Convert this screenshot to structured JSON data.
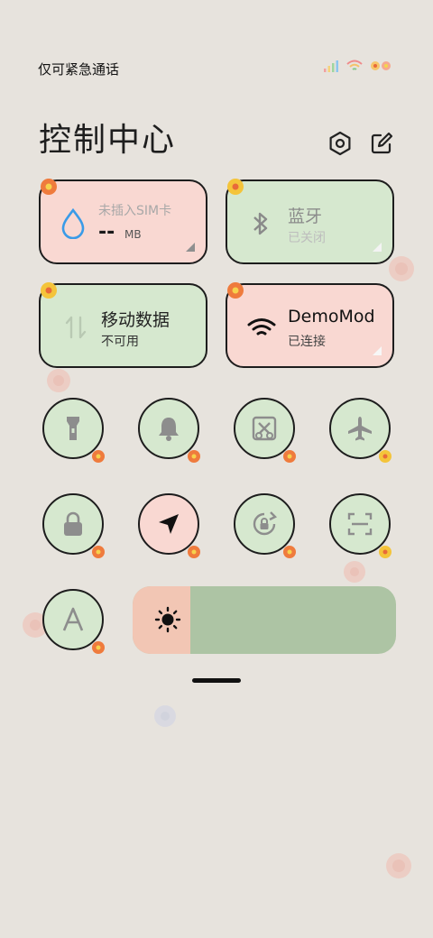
{
  "status_bar": {
    "carrier_text": "仅可紧急通话",
    "icons": [
      "signal-icon",
      "wifi-icon",
      "flower-decoration-icon"
    ]
  },
  "header": {
    "title": "控制中心",
    "icons": [
      "settings-icon",
      "edit-icon"
    ]
  },
  "tiles": {
    "data_usage": {
      "label": "未插入SIM卡",
      "value": "--",
      "unit": "MB",
      "color": "#f9d8d2"
    },
    "bluetooth": {
      "label": "蓝牙",
      "status": "已关闭",
      "color": "#d6e8cf"
    },
    "mobile_data": {
      "label": "移动数据",
      "status": "不可用",
      "color": "#d6e8cf"
    },
    "wifi": {
      "label": "DemoMod",
      "status": "已连接",
      "color": "#f9d8d2"
    }
  },
  "toggles": [
    {
      "name": "flashlight-icon",
      "active": false
    },
    {
      "name": "bell-icon",
      "active": false
    },
    {
      "name": "screenshot-icon",
      "active": false
    },
    {
      "name": "airplane-icon",
      "active": false
    },
    {
      "name": "lock-icon",
      "active": false
    },
    {
      "name": "location-icon",
      "active": true
    },
    {
      "name": "rotation-lock-icon",
      "active": false
    },
    {
      "name": "scan-icon",
      "active": false
    },
    {
      "name": "font-a-icon",
      "active": false
    }
  ],
  "brightness": {
    "level": 0.22,
    "icon": "sun-icon"
  },
  "colors": {
    "green_tile": "#d6e8cf",
    "pink_tile": "#f9d8d2",
    "background": "#e7e3dd"
  }
}
